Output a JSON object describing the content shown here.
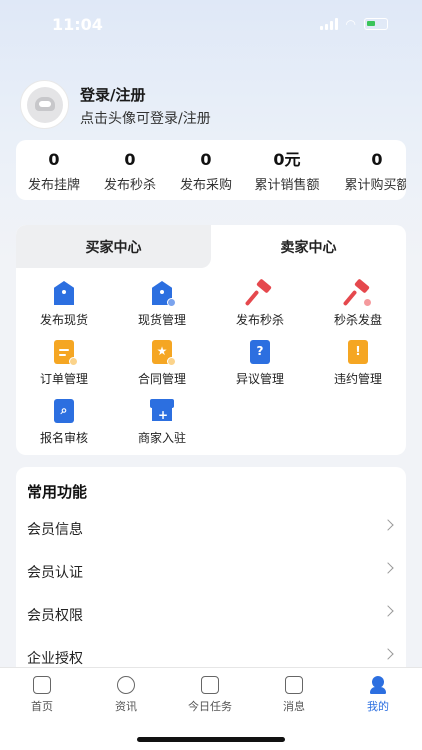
{
  "status_bar": {
    "time": "11:04"
  },
  "profile": {
    "title": "登录/注册",
    "subtitle": "点击头像可登录/注册"
  },
  "stats": [
    {
      "value": "0",
      "label": "发布挂牌"
    },
    {
      "value": "0",
      "label": "发布秒杀"
    },
    {
      "value": "0",
      "label": "发布采购"
    },
    {
      "value": "0元",
      "label": "累计销售额"
    },
    {
      "value": "0",
      "label": "累计购买额"
    }
  ],
  "center": {
    "tabs": [
      {
        "label": "买家中心"
      },
      {
        "label": "卖家中心"
      }
    ],
    "items": [
      {
        "label": "发布现货",
        "icon": "tag-icon"
      },
      {
        "label": "现货管理",
        "icon": "tag-settings-icon"
      },
      {
        "label": "发布秒杀",
        "icon": "hammer-icon"
      },
      {
        "label": "秒杀发盘",
        "icon": "hammer-badge-icon"
      },
      {
        "label": "订单管理",
        "icon": "order-doc-icon"
      },
      {
        "label": "合同管理",
        "icon": "contract-doc-icon"
      },
      {
        "label": "异议管理",
        "icon": "question-doc-icon"
      },
      {
        "label": "违约管理",
        "icon": "warning-doc-icon"
      },
      {
        "label": "报名审核",
        "icon": "search-doc-icon"
      },
      {
        "label": "商家入驻",
        "icon": "shop-icon"
      }
    ]
  },
  "common": {
    "title": "常用功能",
    "rows": [
      {
        "label": "会员信息"
      },
      {
        "label": "会员认证"
      },
      {
        "label": "会员权限"
      },
      {
        "label": "企业授权"
      }
    ]
  },
  "tabbar": [
    {
      "label": "首页",
      "icon": "home-icon"
    },
    {
      "label": "资讯",
      "icon": "news-icon"
    },
    {
      "label": "今日任务",
      "icon": "calendar-icon"
    },
    {
      "label": "消息",
      "icon": "message-icon"
    },
    {
      "label": "我的",
      "icon": "user-icon"
    }
  ],
  "colors": {
    "accent": "#2c6fe0",
    "red": "#e5484d",
    "orange": "#f5a623"
  }
}
